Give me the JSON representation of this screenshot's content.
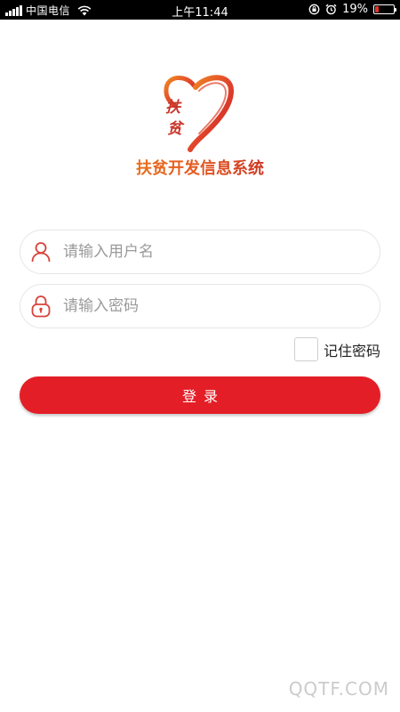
{
  "status_bar": {
    "carrier": "中国电信",
    "time": "上午11:44",
    "battery_text": "19%",
    "battery_level": 0.19,
    "icons": [
      "signal-icon",
      "wifi-icon",
      "orientation-lock-icon",
      "alarm-icon",
      "battery-icon"
    ]
  },
  "logo": {
    "char_top": "扶",
    "char_bottom": "贫",
    "title": "扶贫开发信息系统"
  },
  "form": {
    "username_placeholder": "请输入用户名",
    "username_value": "",
    "password_placeholder": "请输入密码",
    "password_value": "",
    "remember_label": "记住密码",
    "remember_checked": false,
    "login_label": "登录"
  },
  "watermark": {
    "text": "QQTF.COM"
  },
  "colors": {
    "primary": "#e41e26",
    "icon": "#d9423c",
    "logo_orange": "#e8731a",
    "logo_red": "#c93224"
  }
}
